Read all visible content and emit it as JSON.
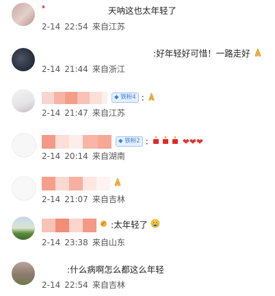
{
  "comments": [
    {
      "text": "天呐这也太年轻了",
      "date": "2-14",
      "time": "22:54",
      "location": "来自江苏"
    },
    {
      "text": ":好年轻好可惜！一路走好",
      "date": "2-14",
      "time": "21:44",
      "location": "来自浙江"
    },
    {
      "text": ":",
      "badge": "铁粉4",
      "date": "2-14",
      "time": "21:47",
      "location": "来自江苏"
    },
    {
      "text": ":",
      "badge": "铁粉2",
      "date": "2-14",
      "time": "20:14",
      "location": "来自湖南"
    },
    {
      "text": "",
      "date": "2-14",
      "time": "21:07",
      "location": "来自吉林"
    },
    {
      "text": ":太年轻了",
      "date": "2-14",
      "time": "23:38",
      "location": "来自山东"
    },
    {
      "text": ":什么病啊怎么都这么年轻",
      "date": "2-14",
      "time": "22:54",
      "location": "来自吉林"
    }
  ],
  "icons": {
    "pray": "folded-hands-icon",
    "candle": "candle-icon",
    "heart": "red-heart-icon",
    "crying": "crying-face-icon",
    "badge_icon": "diamond-badge-icon"
  },
  "colors": {
    "heart": "#e8312f",
    "badge_bg": "#e6f1ff",
    "badge_text": "#3b7fd6"
  }
}
